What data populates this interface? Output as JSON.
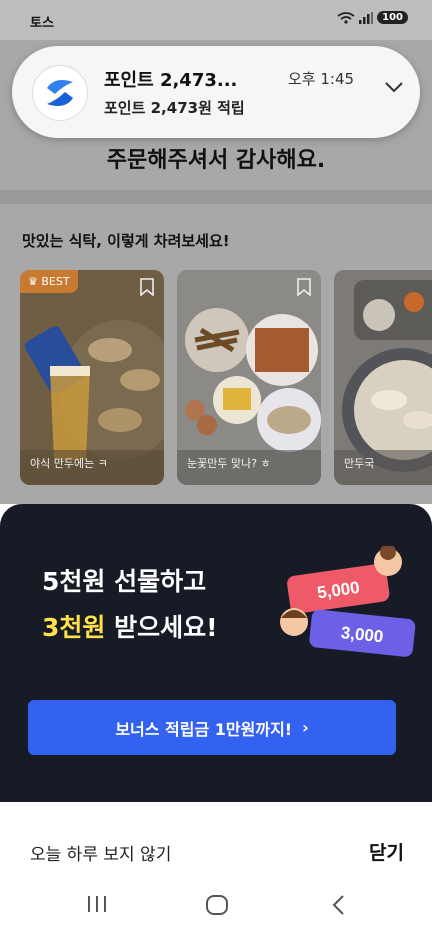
{
  "status_bar": {
    "app_name": "토스",
    "battery": "100"
  },
  "notification": {
    "title": "포인트 2,473...",
    "time": "오후 1:45",
    "body": "포인트 2,473원 적립",
    "icon": "toss-logo-icon",
    "expand_icon": "chevron-down-icon"
  },
  "page": {
    "title": "주문해주셔서 감사해요.",
    "section_title": "맛있는 식탁, 이렇게 차려보세요!",
    "cards": [
      {
        "label": "야식 만두에는 ㅋ",
        "badge": "BEST"
      },
      {
        "label": "눈꽃만두 맞나? ㅎ"
      },
      {
        "label": "만두국"
      }
    ]
  },
  "promo": {
    "line1": "5천원 선물하고",
    "line2_highlight": "3천원",
    "line2_rest": " 받으세요!",
    "ticket1": "5,000",
    "ticket2": "3,000",
    "cta_label": "보너스 적립금 1만원까지!",
    "cta_chevron": "›"
  },
  "footer": {
    "dont_show_today": "오늘 하루 보지 않기",
    "close": "닫기"
  },
  "colors": {
    "promo_bg": "#171b26",
    "cta": "#3361f0",
    "highlight": "#ffe24a",
    "ticket_red": "#ef5a68",
    "ticket_purple": "#6c61e6"
  }
}
